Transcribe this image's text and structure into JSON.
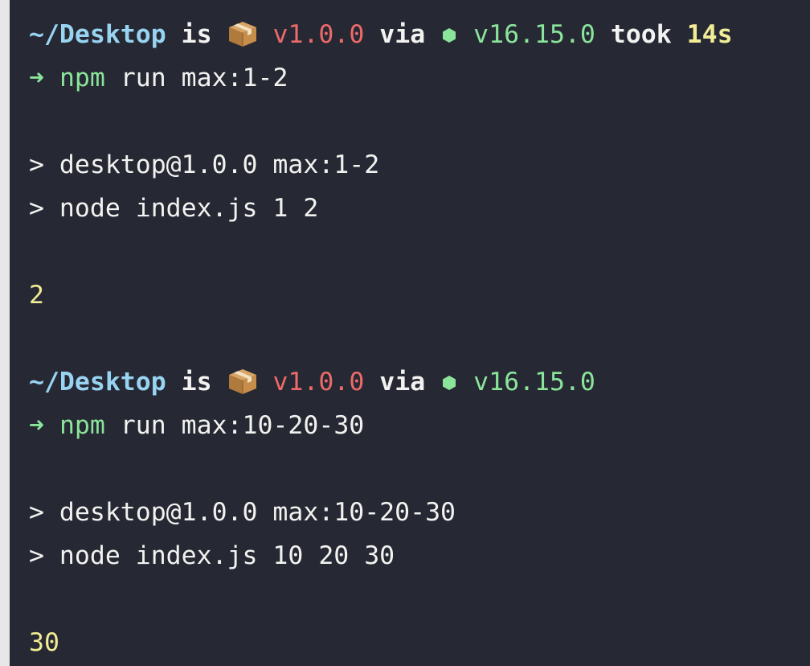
{
  "colors": {
    "background": "#262833",
    "left_border": "#e7e7e9",
    "path": "#98d4f2",
    "text": "#f2f2f0",
    "package_version": "#ec6a6a",
    "node_version": "#8ae59a",
    "duration_and_output": "#f1ec95",
    "prompt_arrow": "#8ae59a"
  },
  "icons": {
    "package": "package-icon",
    "node": "node-hexagon-icon",
    "prompt": "arrow-right-icon"
  },
  "blocks": [
    {
      "prompt": {
        "path": "~/Desktop",
        "is": "is",
        "package_version": "v1.0.0",
        "via": "via",
        "node_version": "v16.15.0",
        "took": "took",
        "duration": "14s"
      },
      "command": {
        "arrow": "➜",
        "program": "npm",
        "args": "run max:1-2"
      },
      "script_lines": [
        "> desktop@1.0.0 max:1-2",
        "> node index.js 1 2"
      ],
      "output": "2"
    },
    {
      "prompt": {
        "path": "~/Desktop",
        "is": "is",
        "package_version": "v1.0.0",
        "via": "via",
        "node_version": "v16.15.0"
      },
      "command": {
        "arrow": "➜",
        "program": "npm",
        "args": "run max:10-20-30"
      },
      "script_lines": [
        "> desktop@1.0.0 max:10-20-30",
        "> node index.js 10 20 30"
      ],
      "output": "30"
    }
  ]
}
